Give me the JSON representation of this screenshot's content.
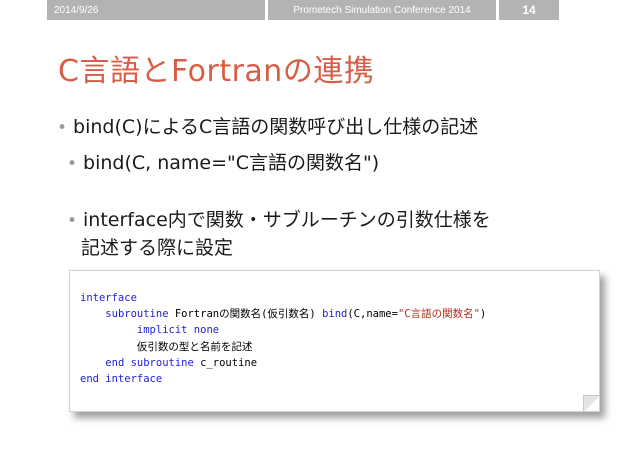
{
  "header": {
    "date": "2014/9/26",
    "conference": "Prometech Simulation Conference 2014",
    "page_number": "14"
  },
  "title": "C言語とFortranの連携",
  "bullets": {
    "b1": "bind(C)によるC言語の関数呼び出し仕様の記述",
    "b2": "bind(C, name=\"C言語の関数名\")",
    "b3_line1": "interface内で関数・サブルーチンの引数仕様を",
    "b3_line2": "記述する際に設定",
    "marker": "•"
  },
  "code": {
    "l1": "interface",
    "l2_kw": "subroutine",
    "l2_plain": " Fortranの関数名(仮引数名) ",
    "l2_kw2": "bind",
    "l2_paren": "(C,name=",
    "l2_str": "\"C言語の関数名\"",
    "l2_close": ")",
    "l3": "implicit none",
    "l4": "仮引数の型と名前を記述",
    "l5_kw": "end subroutine",
    "l5_plain": " c_routine",
    "l6": "end interface"
  },
  "colors": {
    "title": "#d75e46",
    "header_bg": "#b3b3b3",
    "keyword": "#1f1fd8",
    "string": "#c0281e"
  }
}
